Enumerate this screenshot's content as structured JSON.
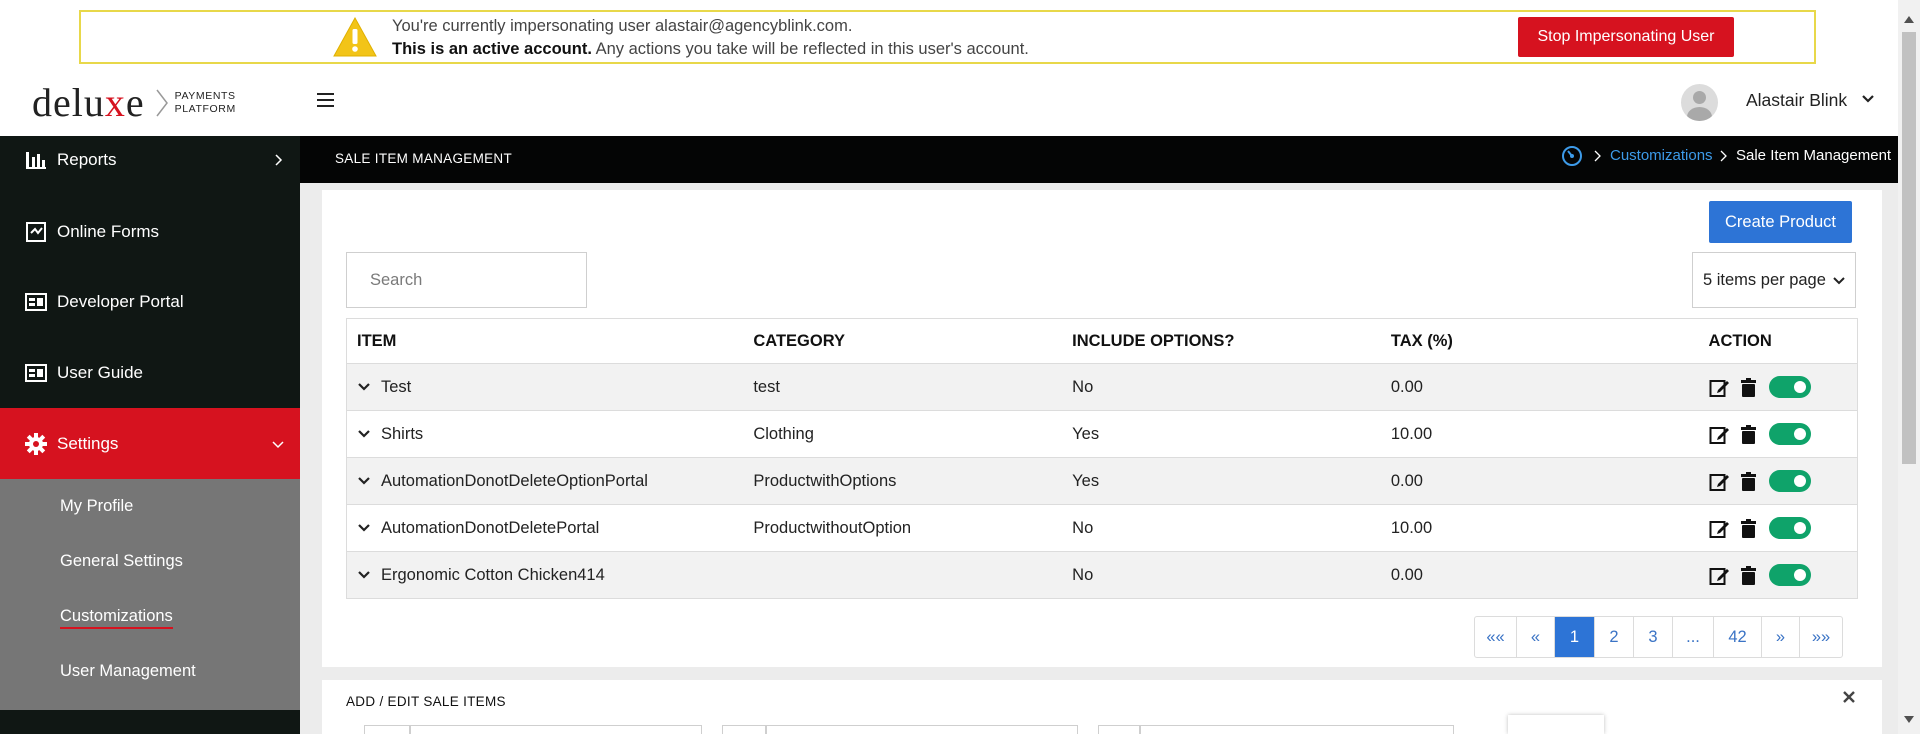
{
  "banner": {
    "line1": "You're currently impersonating user alastair@agencyblink.com.",
    "line2_bold": "This is an active account.",
    "line2_rest": " Any actions you take will be reflected in this user's account.",
    "stop_label": "Stop Impersonating User"
  },
  "logo": {
    "word_pre": "delu",
    "word_x": "x",
    "word_post": "e",
    "sub_line1": "PAYMENTS",
    "sub_line2": "PLATFORM"
  },
  "header": {
    "user_name": "Alastair Blink"
  },
  "sidebar": {
    "items": [
      {
        "label": "Reports",
        "icon": "bar-chart-icon"
      },
      {
        "label": "Online Forms",
        "icon": "online-forms-icon"
      },
      {
        "label": "Developer Portal",
        "icon": "developer-portal-icon"
      },
      {
        "label": "User Guide",
        "icon": "user-guide-icon"
      },
      {
        "label": "Settings",
        "icon": "gear-icon"
      }
    ],
    "submenu": [
      {
        "label": "My Profile"
      },
      {
        "label": "General Settings"
      },
      {
        "label": "Customizations"
      },
      {
        "label": "User Management"
      }
    ]
  },
  "titlebar": {
    "title": "SALE ITEM MANAGEMENT",
    "breadcrumb_link": "Customizations",
    "breadcrumb_current": "Sale Item Management"
  },
  "toolbar": {
    "create_label": "Create Product",
    "search_placeholder": "Search",
    "per_page": "5 items per page"
  },
  "table": {
    "headers": [
      "ITEM",
      "CATEGORY",
      "INCLUDE OPTIONS?",
      "TAX (%)",
      "ACTION"
    ],
    "rows": [
      {
        "item": "Test",
        "category": "test",
        "options": "No",
        "tax": "0.00",
        "enabled": true
      },
      {
        "item": "Shirts",
        "category": "Clothing",
        "options": "Yes",
        "tax": "10.00",
        "enabled": true
      },
      {
        "item": "AutomationDonotDeleteOptionPortal",
        "category": "ProductwithOptions",
        "options": "Yes",
        "tax": "0.00",
        "enabled": true
      },
      {
        "item": "AutomationDonotDeletePortal",
        "category": "ProductwithoutOption",
        "options": "No",
        "tax": "10.00",
        "enabled": true
      },
      {
        "item": "Ergonomic Cotton Chicken414",
        "category": "",
        "options": "No",
        "tax": "0.00",
        "enabled": true
      }
    ]
  },
  "pager": {
    "first": "««",
    "prev": "«",
    "pages": [
      "1",
      "2",
      "3",
      "...",
      "42"
    ],
    "current": "1",
    "next": "»",
    "last": "»»"
  },
  "edit_section": {
    "title": "ADD / EDIT SALE ITEMS"
  },
  "colors": {
    "brand_red": "#d6121f",
    "primary_blue": "#2d74d6",
    "link_blue": "#3d9be9",
    "toggle_green": "#0fa36a",
    "sidebar_bg": "#101714"
  }
}
